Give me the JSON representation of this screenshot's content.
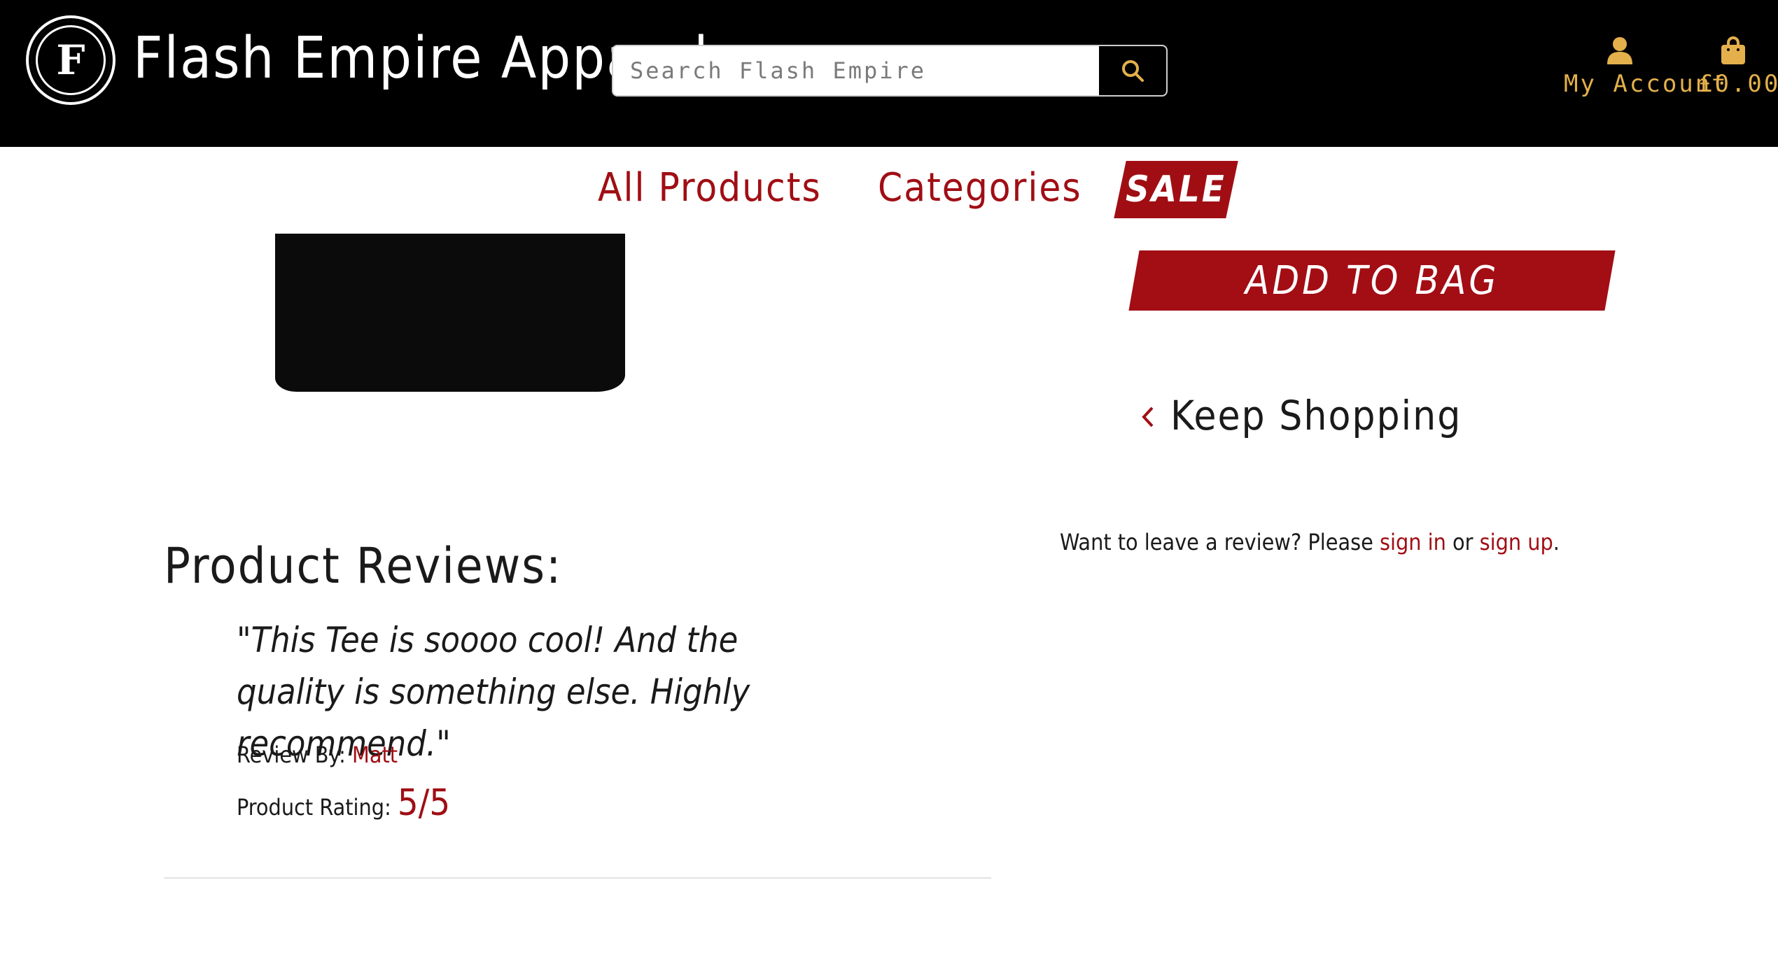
{
  "header": {
    "brand": "Flash Empire Apparel",
    "logo_letter": "F",
    "search_placeholder": "Search Flash Empire",
    "account_label": "My Account",
    "bag_total": "£0.00",
    "accent_color": "#e3b04b"
  },
  "nav": {
    "items": [
      {
        "label": "All Products"
      },
      {
        "label": "Categories"
      }
    ],
    "sale_label": "SALE",
    "brand_red": "#a00e14"
  },
  "product": {
    "add_to_bag_label": "ADD TO BAG",
    "keep_shopping_label": "Keep Shopping"
  },
  "review_prompt": {
    "text_before": "Want to leave a review? Please ",
    "sign_in": "sign in",
    "middle": " or ",
    "sign_up": "sign up",
    "end": "."
  },
  "reviews": {
    "title": "Product Reviews:",
    "items": [
      {
        "quote": "\"This Tee is soooo cool! And the quality is something else. Highly recommend.\"",
        "by_label": "Review By: ",
        "author": "Matt",
        "rating_label": "Product Rating: ",
        "rating": "5/5"
      }
    ]
  }
}
